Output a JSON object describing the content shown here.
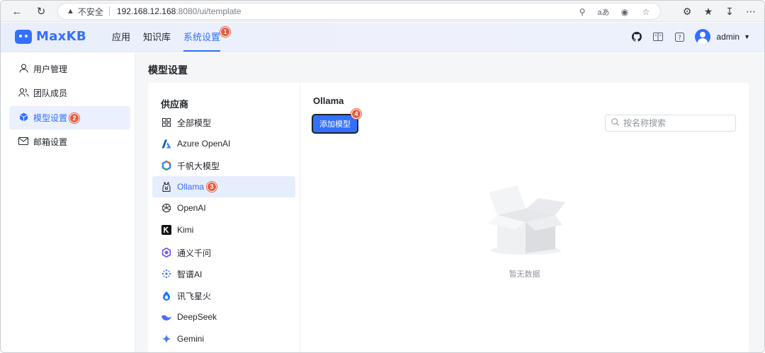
{
  "browser": {
    "security_label": "不安全",
    "url_host": "192.168.12.168",
    "url_path": ":8080/ui/template"
  },
  "app": {
    "logo_text": "MaxKB",
    "nav": [
      {
        "label": "应用"
      },
      {
        "label": "知识库"
      },
      {
        "label": "系统设置",
        "active": true,
        "badge": "1"
      }
    ],
    "username": "admin"
  },
  "sidebar": {
    "items": [
      {
        "label": "用户管理",
        "icon": "user-icon"
      },
      {
        "label": "团队成员",
        "icon": "team-icon"
      },
      {
        "label": "模型设置",
        "icon": "cube-icon",
        "active": true,
        "badge": "2"
      },
      {
        "label": "邮箱设置",
        "icon": "mail-icon"
      }
    ]
  },
  "main": {
    "page_title": "模型设置",
    "provider_title": "供应商",
    "providers": [
      {
        "label": "全部模型",
        "icon": "grid-icon"
      },
      {
        "label": "Azure OpenAI",
        "icon": "azure-icon"
      },
      {
        "label": "千帆大模型",
        "icon": "qianfan-icon"
      },
      {
        "label": "Ollama",
        "icon": "ollama-icon",
        "active": true,
        "badge": "3"
      },
      {
        "label": "OpenAI",
        "icon": "openai-icon"
      },
      {
        "label": "Kimi",
        "icon": "kimi-icon"
      },
      {
        "label": "通义千问",
        "icon": "tongyi-icon"
      },
      {
        "label": "智谱AI",
        "icon": "zhipu-icon"
      },
      {
        "label": "讯飞星火",
        "icon": "xunfei-icon"
      },
      {
        "label": "DeepSeek",
        "icon": "deepseek-icon"
      },
      {
        "label": "Gemini",
        "icon": "gemini-icon"
      }
    ],
    "content_title": "Ollama",
    "add_button_label": "添加模型",
    "add_button_badge": "4",
    "search_placeholder": "按名称搜索",
    "empty_text": "暂无数据"
  },
  "colors": {
    "accent": "#3370ff",
    "badge": "#e35b3f"
  }
}
